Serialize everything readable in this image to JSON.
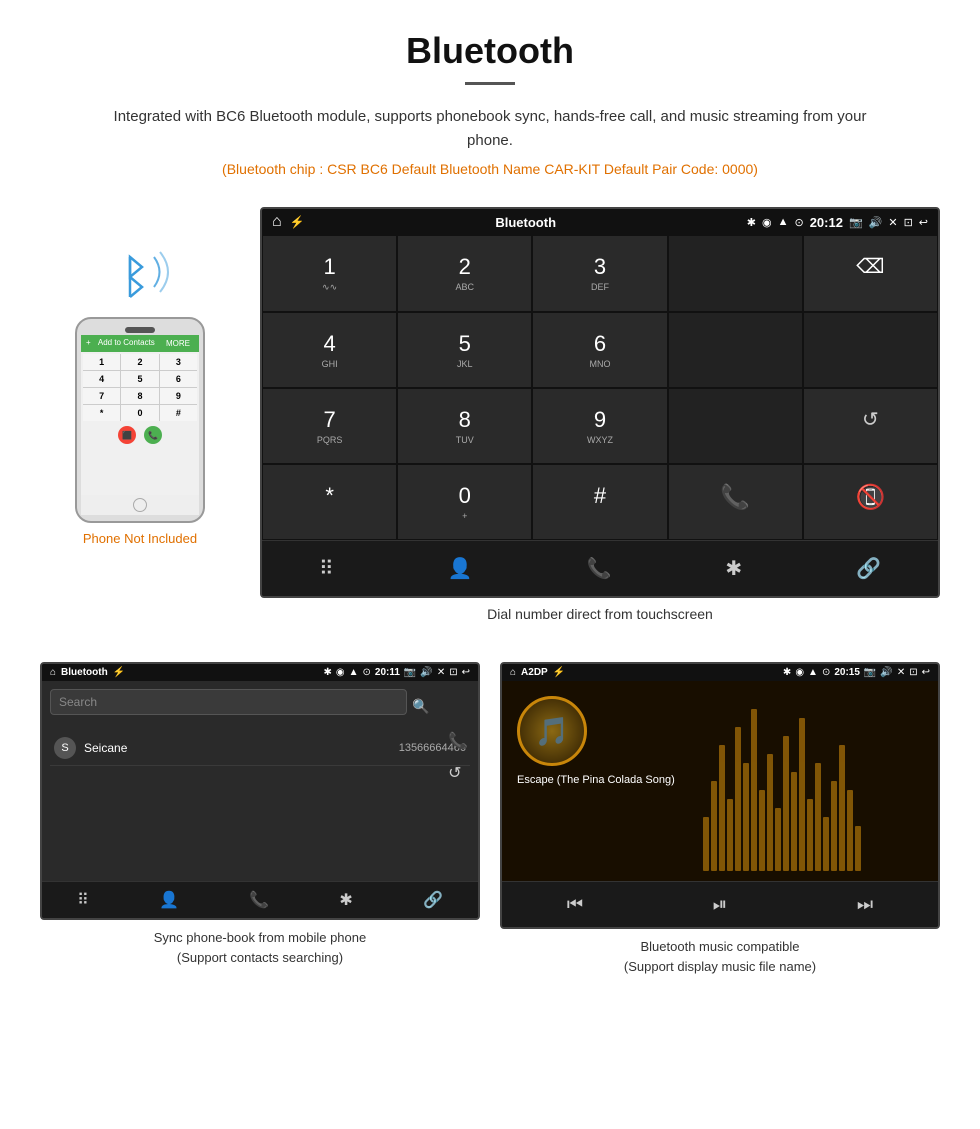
{
  "header": {
    "title": "Bluetooth",
    "description": "Integrated with BC6 Bluetooth module, supports phonebook sync, hands-free call, and music streaming from your phone.",
    "specs": "(Bluetooth chip : CSR BC6    Default Bluetooth Name CAR-KIT    Default Pair Code: 0000)"
  },
  "phone_area": {
    "not_included_label": "Phone Not Included"
  },
  "car_unit": {
    "status_bar": {
      "app_name": "Bluetooth",
      "time": "20:12"
    },
    "dialpad": {
      "keys": [
        {
          "label": "1",
          "sub": "∿∿"
        },
        {
          "label": "2",
          "sub": "ABC"
        },
        {
          "label": "3",
          "sub": "DEF"
        },
        {
          "label": "",
          "sub": ""
        },
        {
          "label": "⌫",
          "sub": ""
        },
        {
          "label": "4",
          "sub": "GHI"
        },
        {
          "label": "5",
          "sub": "JKL"
        },
        {
          "label": "6",
          "sub": "MNO"
        },
        {
          "label": "",
          "sub": ""
        },
        {
          "label": "",
          "sub": ""
        },
        {
          "label": "7",
          "sub": "PQRS"
        },
        {
          "label": "8",
          "sub": "TUV"
        },
        {
          "label": "9",
          "sub": "WXYZ"
        },
        {
          "label": "",
          "sub": ""
        },
        {
          "label": "↺",
          "sub": ""
        },
        {
          "label": "*",
          "sub": ""
        },
        {
          "label": "0",
          "sub": "+"
        },
        {
          "label": "#",
          "sub": ""
        },
        {
          "label": "📞",
          "sub": ""
        },
        {
          "label": "📵",
          "sub": ""
        }
      ]
    },
    "caption": "Dial number direct from touchscreen"
  },
  "phonebook_screen": {
    "status_bar": {
      "app_name": "Bluetooth",
      "time": "20:11"
    },
    "search_placeholder": "Search",
    "contacts": [
      {
        "initial": "S",
        "name": "Seicane",
        "number": "13566664466"
      }
    ],
    "caption": "Sync phone-book from mobile phone\n(Support contacts searching)"
  },
  "music_screen": {
    "status_bar": {
      "app_name": "A2DP",
      "time": "20:15"
    },
    "song_title": "Escape (The Pina Colada Song)",
    "caption": "Bluetooth music compatible\n(Support display music file name)"
  },
  "colors": {
    "accent": "#e07000",
    "screen_bg": "#1a1a1a",
    "status_bar_bg": "#111111",
    "dialpad_key_bg": "#2a2a2a",
    "call_green": "#4caf50",
    "call_red": "#f44336"
  }
}
